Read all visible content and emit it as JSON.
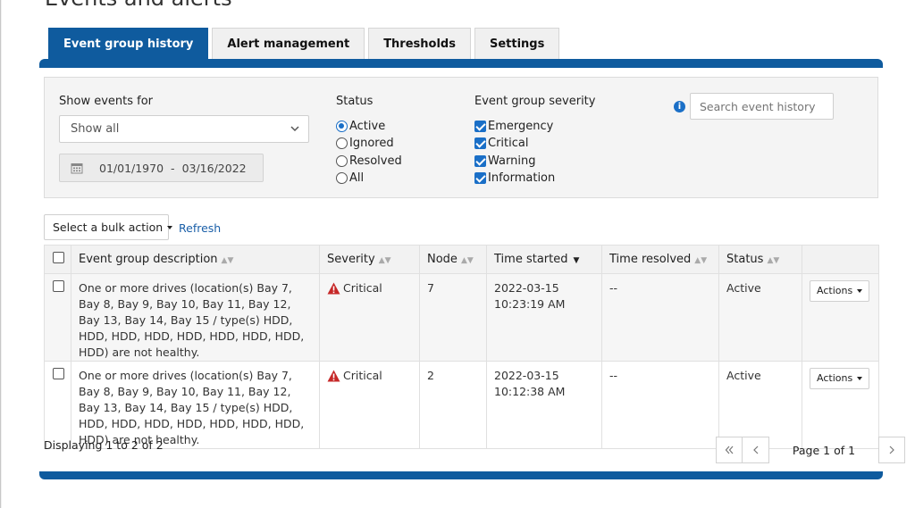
{
  "page": {
    "title": "Events and alerts"
  },
  "tabs": [
    {
      "label": "Event group history",
      "active": true
    },
    {
      "label": "Alert management",
      "active": false
    },
    {
      "label": "Thresholds",
      "active": false
    },
    {
      "label": "Settings",
      "active": false
    }
  ],
  "filters": {
    "show_events_label": "Show events for",
    "show_events_value": "Show all",
    "date_from": "01/01/1970",
    "date_separator": "-",
    "date_to": "03/16/2022",
    "status_label": "Status",
    "status_options": [
      {
        "label": "Active",
        "selected": true
      },
      {
        "label": "Ignored",
        "selected": false
      },
      {
        "label": "Resolved",
        "selected": false
      },
      {
        "label": "All",
        "selected": false
      }
    ],
    "severity_label": "Event group severity",
    "severity_options": [
      {
        "label": "Emergency",
        "checked": true
      },
      {
        "label": "Critical",
        "checked": true
      },
      {
        "label": "Warning",
        "checked": true
      },
      {
        "label": "Information",
        "checked": true
      }
    ],
    "search_placeholder": "Search event history"
  },
  "toolbar": {
    "bulk_action_label": "Select a bulk action",
    "refresh_label": "Refresh"
  },
  "table": {
    "columns": [
      "Event group description",
      "Severity",
      "Node",
      "Time started",
      "Time resolved",
      "Status"
    ],
    "rows": [
      {
        "description": "One or more drives (location(s) Bay 7, Bay 8, Bay 9, Bay 10, Bay 11, Bay 12, Bay 13, Bay 14, Bay 15 / type(s) HDD, HDD, HDD, HDD, HDD, HDD, HDD, HDD, HDD) are not healthy.",
        "severity": "Critical",
        "node": "7",
        "time_started_date": "2022-03-15",
        "time_started_time": "10:23:19 AM",
        "time_resolved": "--",
        "status": "Active",
        "actions_label": "Actions"
      },
      {
        "description": "One or more drives (location(s) Bay 7, Bay 8, Bay 9, Bay 10, Bay 11, Bay 12, Bay 13, Bay 14, Bay 15 / type(s) HDD, HDD, HDD, HDD, HDD, HDD, HDD, HDD, HDD) are not healthy.",
        "severity": "Critical",
        "node": "2",
        "time_started_date": "2022-03-15",
        "time_started_time": "10:12:38 AM",
        "time_resolved": "--",
        "status": "Active",
        "actions_label": "Actions"
      }
    ]
  },
  "footer": {
    "displaying": "Displaying 1 to 2 of 2",
    "page_info": "Page 1 of 1"
  },
  "icons": {
    "first_page": "double-chevron-left",
    "prev_page": "chevron-left",
    "next_page": "chevron-right",
    "severity_critical": "warning-triangle",
    "date": "calendar",
    "info": "info-circle"
  },
  "colors": {
    "accent": "#0f5b9e",
    "link": "#1a5fa8",
    "critical": "#c62828",
    "check": "#1a6fc7"
  }
}
